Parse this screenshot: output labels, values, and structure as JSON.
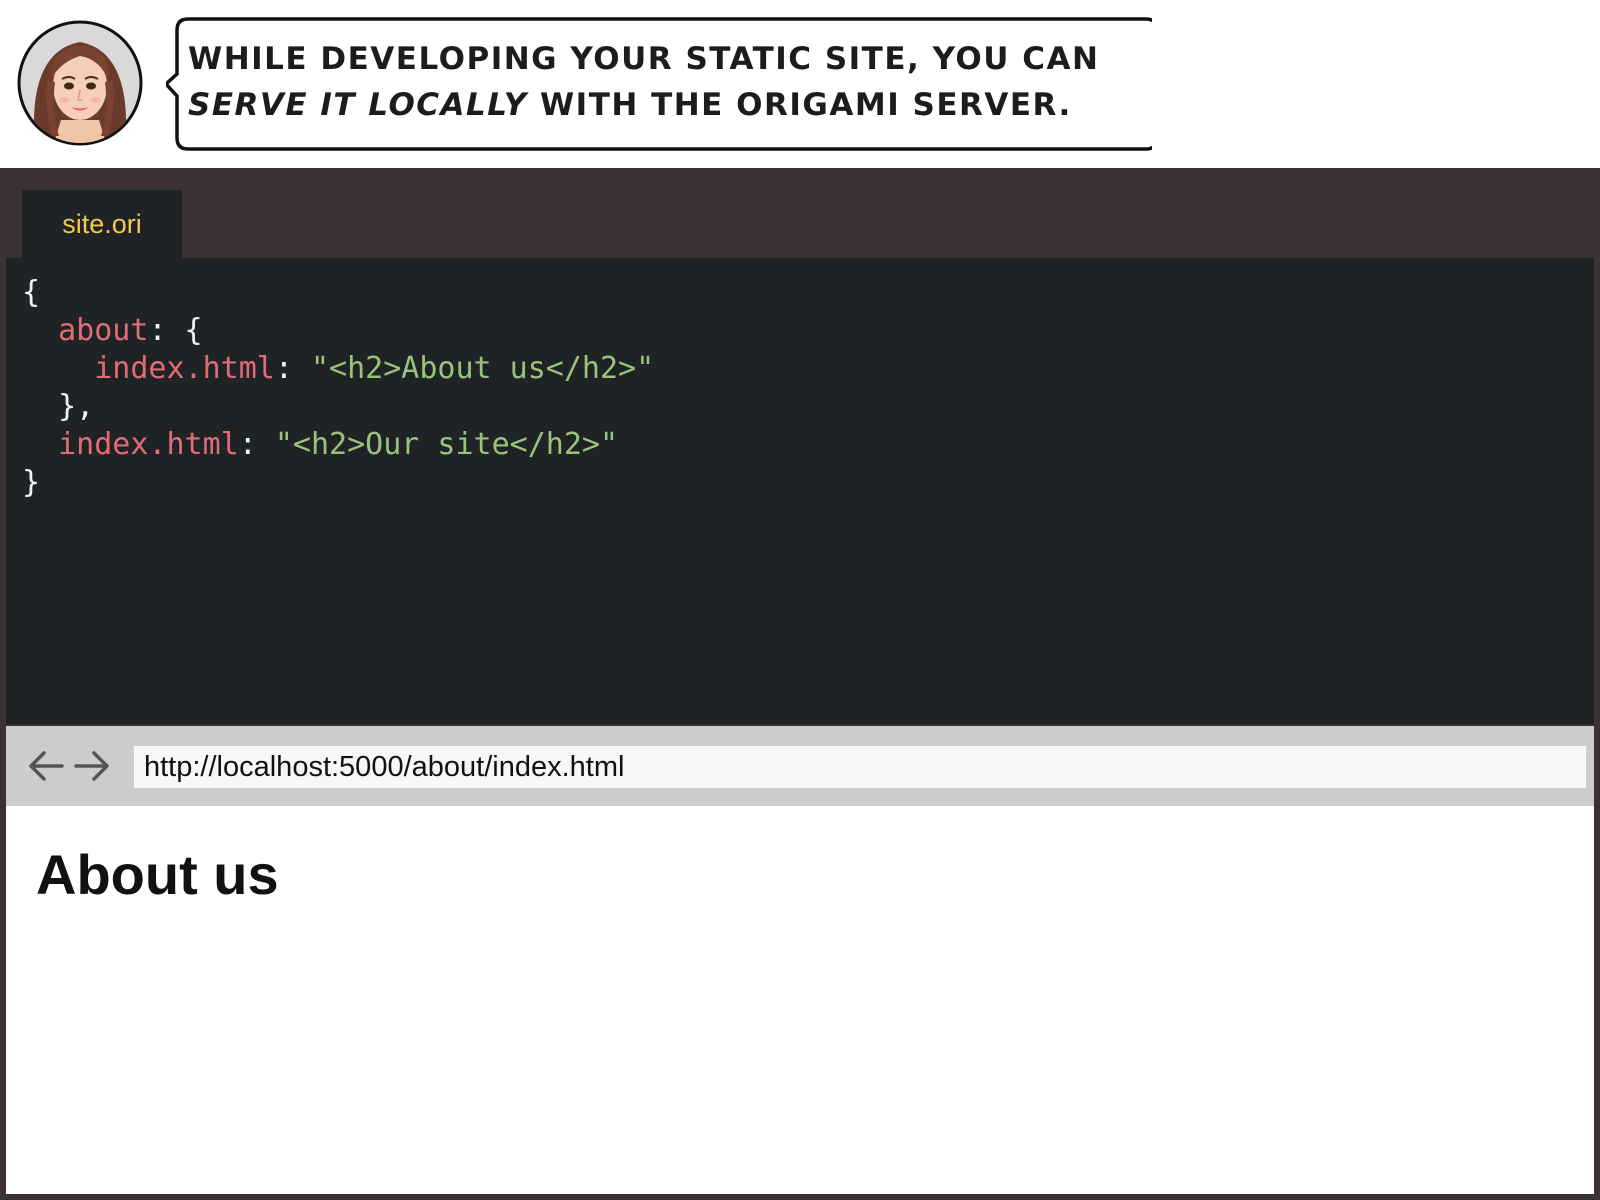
{
  "comic": {
    "speech_line1": "While developing your static site, you can",
    "speech_line2_emphasis": "serve it locally",
    "speech_line2_rest": " with the Origami server.",
    "avatar": "avatar-illustration"
  },
  "editor": {
    "tab_label": "site.ori",
    "code": [
      [
        {
          "t": "{",
          "c": "p"
        }
      ],
      [
        {
          "t": "  ",
          "c": "p"
        },
        {
          "t": "about",
          "c": "k"
        },
        {
          "t": ": {",
          "c": "p"
        }
      ],
      [
        {
          "t": "    ",
          "c": "p"
        },
        {
          "t": "index.html",
          "c": "k"
        },
        {
          "t": ": ",
          "c": "p"
        },
        {
          "t": "\"<h2>About us</h2>\"",
          "c": "s"
        }
      ],
      [
        {
          "t": "  },",
          "c": "p"
        }
      ],
      [
        {
          "t": "  ",
          "c": "p"
        },
        {
          "t": "index.html",
          "c": "k"
        },
        {
          "t": ": ",
          "c": "p"
        },
        {
          "t": "\"<h2>Our site</h2>\"",
          "c": "s"
        }
      ],
      [
        {
          "t": "}",
          "c": "p"
        }
      ]
    ],
    "colors": {
      "key": "#e06c75",
      "string": "#98c379",
      "punctuation": "#f2f2f2",
      "tab_label": "#f2c94c",
      "background": "#1f2326",
      "frame": "#3a3233"
    }
  },
  "browser": {
    "back_icon": "arrow-left-icon",
    "forward_icon": "arrow-right-icon",
    "url": "http://localhost:5000/about/index.html",
    "page_heading": "About us"
  }
}
